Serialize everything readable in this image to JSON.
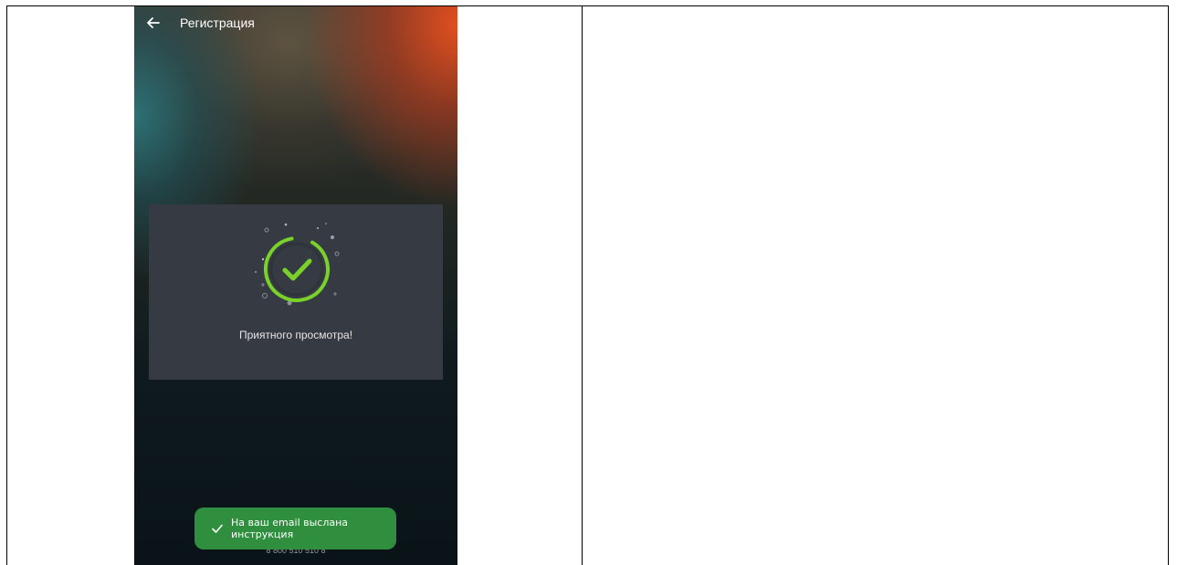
{
  "header": {
    "title": "Регистрация",
    "back_icon": "arrow-left-icon"
  },
  "card": {
    "message": "Приятного просмотра!",
    "icon": "success-check-icon",
    "accent_color": "#7ad12a"
  },
  "toast": {
    "text": "На ваш email выслана инструкция",
    "icon": "check-icon",
    "background": "#2f8f3f"
  },
  "footer": {
    "phone": "8 800 510 510 8"
  }
}
